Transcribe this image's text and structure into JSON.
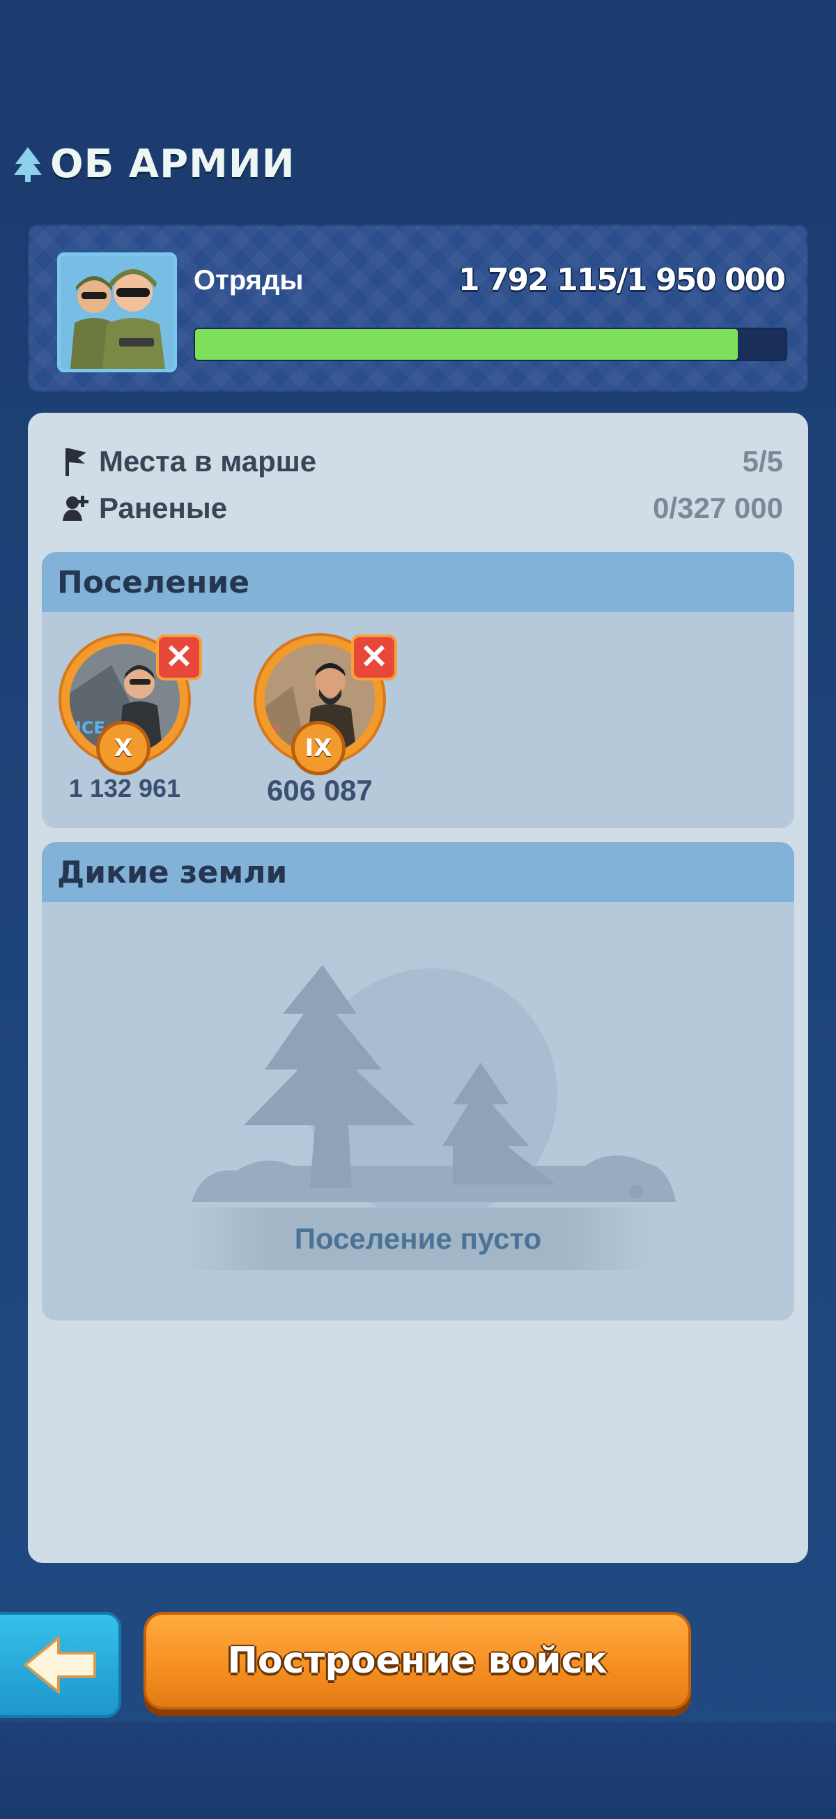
{
  "header": {
    "title": "ОБ АРМИИ",
    "icon": "tree-icon"
  },
  "troops": {
    "label": "Отряды",
    "value": "1 792 115/1 950 000",
    "progress_fraction": 0.919,
    "bar_color": "#7ee05a"
  },
  "stats": [
    {
      "icon": "flag-icon",
      "label": "Места в марше",
      "value": "5/5"
    },
    {
      "icon": "wounded-icon",
      "label": "Раненые",
      "value": "0/327 000"
    }
  ],
  "settlement": {
    "title": "Поселение",
    "heroes": [
      {
        "rank": "X",
        "power": "1 132 961"
      },
      {
        "rank": "IX",
        "power": "606 087"
      }
    ]
  },
  "wildlands": {
    "title": "Дикие земли",
    "empty_text": "Поселение пусто"
  },
  "footer": {
    "back_icon": "arrow-left-icon",
    "build_label": "Построение войск"
  },
  "colors": {
    "background": "#1e4479",
    "accent_orange": "#f58e21",
    "accent_blue": "#36c0ea",
    "panel": "#d0dce6"
  }
}
